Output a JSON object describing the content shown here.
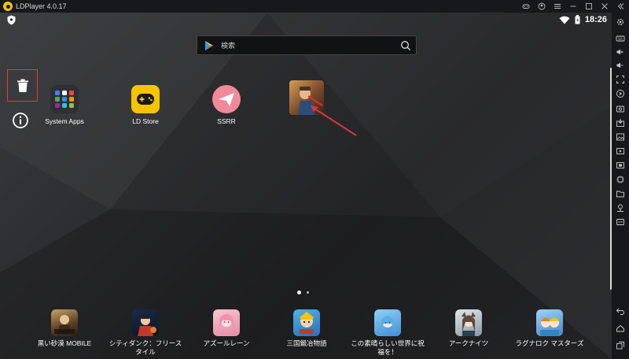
{
  "window": {
    "title": "LDPlayer 4.0.17"
  },
  "status_bar": {
    "time": "18:26"
  },
  "search": {
    "placeholder": "検索"
  },
  "desktop_apps": [
    {
      "label": "System Apps",
      "icon": "folder-grid-icon"
    },
    {
      "label": "LD Store",
      "icon": "gamepad-icon",
      "color": "#f5c400"
    },
    {
      "label": "SSRR",
      "icon": "paper-plane-icon",
      "color": "#f08a9a"
    },
    {
      "label": "",
      "icon": "game-art-icon"
    }
  ],
  "dock_apps": [
    {
      "label": "黒い砂漠 MOBILE"
    },
    {
      "label": "シティダンク：フリース タイル"
    },
    {
      "label": "アズールレーン"
    },
    {
      "label": "三国鍛冶物語"
    },
    {
      "label": "この素晴らしい世界に祝 福を！"
    },
    {
      "label": "アークナイツ"
    },
    {
      "label": "ラグナロク マスターズ"
    }
  ],
  "colors": {
    "accent_yellow": "#f5c400",
    "highlight_red": "#e23b3b",
    "sidebar_bg": "#17181b"
  }
}
